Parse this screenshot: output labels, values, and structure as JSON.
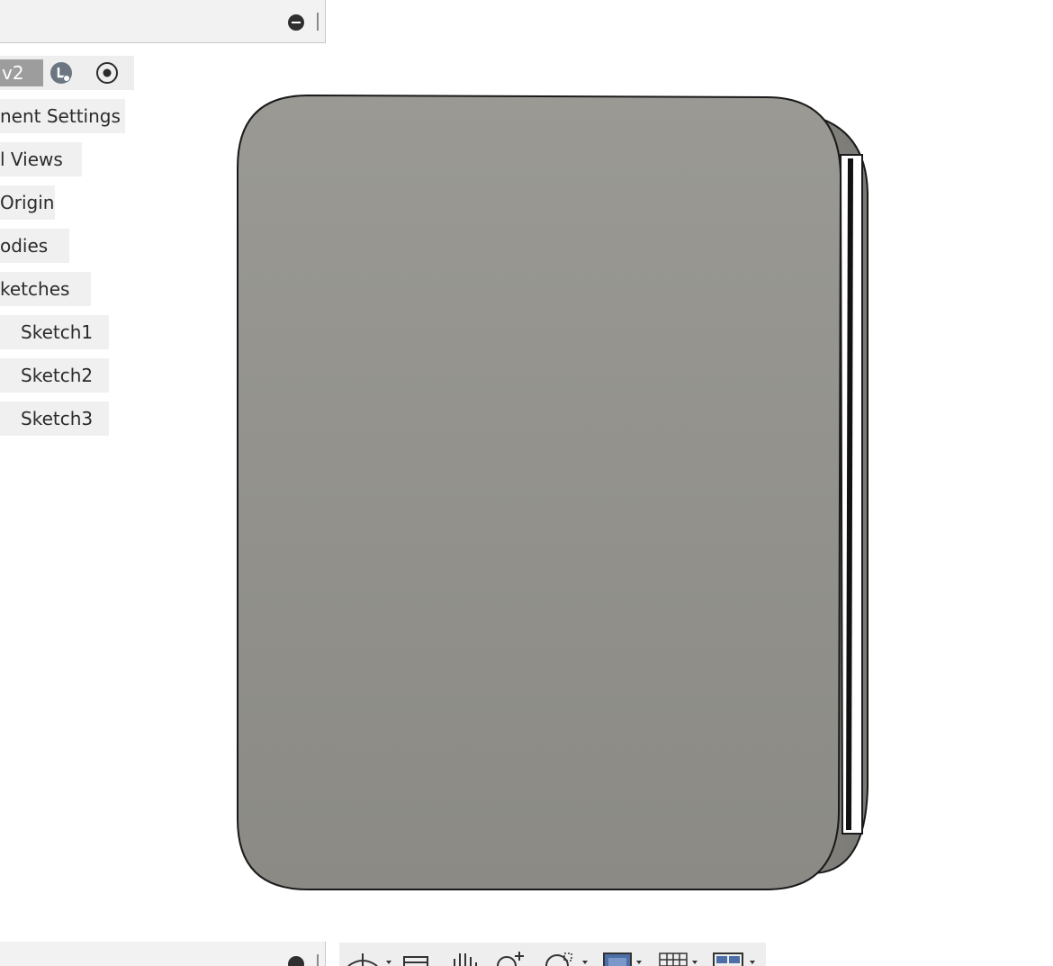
{
  "browser": {
    "component": {
      "version_label": "v2"
    },
    "items": [
      {
        "label": "nent Settings"
      },
      {
        "label": "l Views"
      },
      {
        "label": "Origin"
      },
      {
        "label": "odies"
      },
      {
        "label": "ketches"
      },
      {
        "label": "Sketch1"
      },
      {
        "label": "Sketch2"
      },
      {
        "label": "Sketch3"
      }
    ]
  },
  "icons": {
    "collapse": "minus-circle-icon",
    "light": "lightbulb-icon",
    "visibility": "radio-target-icon",
    "expand": "plus-circle-icon",
    "orbit": "orbit-icon",
    "look_at": "look-at-icon",
    "pan": "pan-hand-icon",
    "zoom": "zoom-icon",
    "fit": "zoom-window-icon",
    "display": "display-settings-icon",
    "grid": "grid-icon",
    "viewports": "viewports-icon"
  },
  "colors": {
    "model_face_top": "#9a9993",
    "model_face_bottom": "#8b8a84",
    "model_side": "#7d7c77",
    "outline": "#1a1a1a"
  }
}
